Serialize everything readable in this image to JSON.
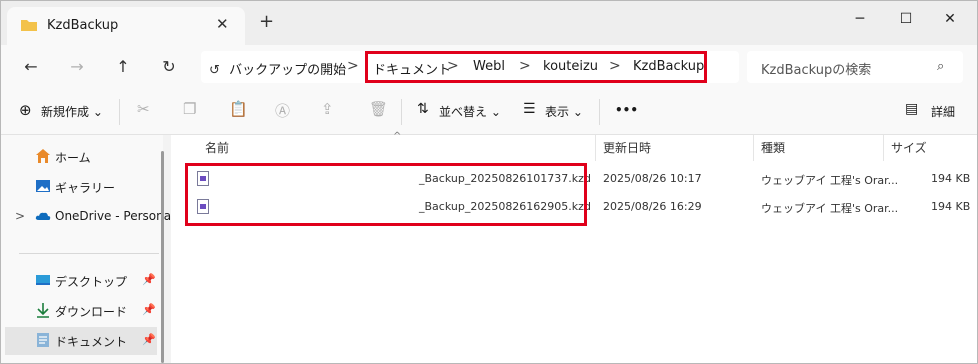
{
  "tab": {
    "title": "KzdBackup",
    "close": "✕",
    "new": "+"
  },
  "window_controls": {
    "minimize": "─",
    "maximize": "☐",
    "close": "✕"
  },
  "nav": {
    "back": "←",
    "forward": "→",
    "up": "↑",
    "refresh": "↻"
  },
  "address": {
    "home_icon": "↺",
    "home_label": "バックアップの開始",
    "separator": ">",
    "crumbs": [
      "ドキュメント",
      "Webl",
      "kouteizu",
      "KzdBackup"
    ]
  },
  "search": {
    "placeholder": "KzdBackupの検索",
    "icon": "⌕"
  },
  "toolbar": {
    "new_icon": "⊕",
    "new_label": "新規作成 ⌄",
    "cut_icon": "✂",
    "copy_icon": "❐",
    "paste_icon": "📋",
    "rename_icon": "Ⓐ",
    "share_icon": "⇪",
    "delete_icon": "🗑",
    "sort_icon": "⇅",
    "sort_label": "並べ替え ⌄",
    "view_icon": "☰",
    "view_label": "表示 ⌄",
    "more": "•••",
    "details_icon": "▤",
    "details_label": "詳細"
  },
  "sidebar": {
    "items": [
      {
        "label": "ホーム"
      },
      {
        "label": "ギャラリー"
      },
      {
        "label": "OneDrive - Persona",
        "chevron": ">"
      },
      {
        "label": "デスクトップ",
        "pin": "📌"
      },
      {
        "label": "ダウンロード",
        "pin": "📌"
      },
      {
        "label": "ドキュメント",
        "pin": "📌"
      }
    ]
  },
  "table": {
    "sort_caret": "^",
    "columns": [
      "名前",
      "更新日時",
      "種類",
      "サイズ"
    ],
    "rows": [
      {
        "name": "_Backup_20250826101737.kzd",
        "date": "2025/08/26 10:17",
        "type": "ウェッブアイ 工程's Orar...",
        "size": "194 KB"
      },
      {
        "name": "_Backup_20250826162905.kzd",
        "date": "2025/08/26 16:29",
        "type": "ウェッブアイ 工程's Orar...",
        "size": "194 KB"
      }
    ]
  },
  "colors": {
    "highlight": "#e0001b",
    "folder": "#f3c24a",
    "onedrive": "#0f6cbd"
  }
}
